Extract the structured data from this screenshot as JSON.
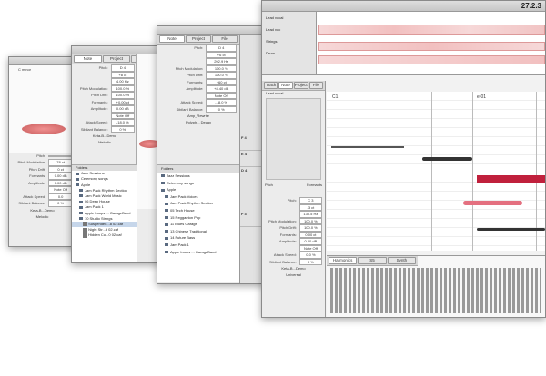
{
  "w1": {
    "key": "C minor",
    "params": [
      [
        "Pitch:",
        ""
      ],
      [
        "Pitch Modulation:",
        "78 ct"
      ],
      [
        "Pitch Drift:",
        "0 ct"
      ],
      [
        "Formants:",
        "0.00 dB"
      ],
      [
        "Amplitude:",
        "0.00 dB"
      ],
      [
        "",
        "Note Off"
      ],
      [
        "Attack Speed:",
        "0.0"
      ],
      [
        "Sibilant Balance:",
        "0 %"
      ]
    ],
    "file": "Keta-B...Demo",
    "algorithm": "Melodic"
  },
  "w2": {
    "tabs": [
      "Note",
      "Project",
      "File"
    ],
    "params": [
      [
        "Pitch:",
        "D 4"
      ],
      [
        "",
        "+8 ct"
      ],
      [
        "",
        "4.00 Hz"
      ],
      [
        "Pitch Modulation:",
        "100.0 %"
      ],
      [
        "Pitch Drift:",
        "100.0 %"
      ],
      [
        "Formants:",
        "+0.00 ct"
      ],
      [
        "Amplitude:",
        "0.00 dB"
      ],
      [
        "",
        "Note Off"
      ],
      [
        "Attack Speed:",
        "-18.0 %"
      ],
      [
        "Sibilant Balance:",
        "0 %"
      ]
    ],
    "file": "Keta-B...Demo",
    "algorithm": "Melodic",
    "folders": "Folders",
    "items": [
      "Jazz Sessions",
      "Celemony songs",
      "Apple",
      "Jam Pack Rhythm Section",
      "Jam Pack World Music",
      "06 Deep House",
      "Jam Pack 1",
      "Apple Loops ... GarageBand",
      "10 Studio Strings",
      "Suspended...8 02.caf",
      "Night Str...d 02.caf",
      "Hidden Cu...0 02.caf"
    ]
  },
  "w3": {
    "tabs": [
      "Note",
      "Project",
      "File"
    ],
    "params": [
      [
        "Pitch:",
        "D 4"
      ],
      [
        "",
        "+6 ct"
      ],
      [
        "",
        "292.9 Hz"
      ],
      [
        "Pitch Modulation:",
        "100.0 %"
      ],
      [
        "Pitch Drift:",
        "100.0 %"
      ],
      [
        "Formants:",
        "+60 ct"
      ],
      [
        "Amplitude:",
        "+8.40 dB"
      ],
      [
        "",
        "Note Off"
      ],
      [
        "Attack Speed:",
        "-18.0 %"
      ],
      [
        "Sibilant Balance:",
        "0 %"
      ]
    ],
    "file": "Amp_Rewrite",
    "algorithm": "Polyph... Decay",
    "folders": "Folders",
    "items": [
      "Jazz Sessions",
      "Celemony songs",
      "Apple",
      "Jam Pack Voices",
      "Jam Pack Rhythm Section",
      "05 Tech House",
      "15 Reggaeton Pop",
      "11 Blues Garage",
      "13 Chinese Traditional",
      "14 Future Bass",
      "Jam Pack 1",
      "Apple Loops ... GarageBand"
    ],
    "keys": [
      "F 4",
      "E 4",
      "D 4",
      "F 3"
    ]
  },
  "w4": {
    "counter": "27.2.3",
    "tracks": [
      "Lead vocal",
      "Lead voc",
      "Strings",
      "Drum"
    ],
    "tabs": [
      "Track",
      "Note",
      "Project",
      "File"
    ],
    "track_name": "Lead vocal",
    "note_c": "C1",
    "note_e": "e-01",
    "pitch_label": "Pitch",
    "formants_label": "Formants",
    "params": [
      [
        "Pitch:",
        "C 3"
      ],
      [
        "",
        "-3 ct"
      ],
      [
        "",
        "130.5 Hz"
      ],
      [
        "Pitch Modulation:",
        "100.0 %"
      ],
      [
        "Pitch Drift:",
        "100.0 %"
      ],
      [
        "Formants:",
        "0.00 ct"
      ],
      [
        "Amplitude:",
        "0.00 dB"
      ],
      [
        "",
        "Note Off"
      ],
      [
        "Attack Speed:",
        "0.0 %"
      ],
      [
        "Sibilant Balance:",
        "0 %"
      ]
    ],
    "file": "Keta-B...Demo",
    "algorithm": "Universal",
    "bottom_tabs": [
      "Harmonics",
      "S5",
      "Synth"
    ]
  }
}
